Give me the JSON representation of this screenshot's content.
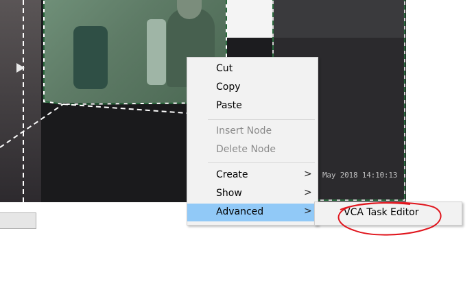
{
  "video": {
    "osd_timestamp": "May 2018  14:10:13"
  },
  "context_menu": {
    "items": [
      {
        "label": "Cut",
        "enabled": true
      },
      {
        "label": "Copy",
        "enabled": true
      },
      {
        "label": "Paste",
        "enabled": true
      },
      {
        "label": "Insert Node",
        "enabled": false
      },
      {
        "label": "Delete Node",
        "enabled": false
      },
      {
        "label": "Create",
        "enabled": true,
        "has_submenu": true
      },
      {
        "label": "Show",
        "enabled": true,
        "has_submenu": true
      },
      {
        "label": "Advanced",
        "enabled": true,
        "has_submenu": true,
        "highlighted": true
      }
    ],
    "submenu_icon": "chevron-right-icon",
    "submenu_glyph": ">"
  },
  "advanced_submenu": {
    "items": [
      {
        "label": "VCA Task Editor"
      }
    ]
  },
  "colors": {
    "menu_highlight": "#91c9f7",
    "annotation_red": "#e0141c",
    "zone_green": "#5e7b66"
  }
}
